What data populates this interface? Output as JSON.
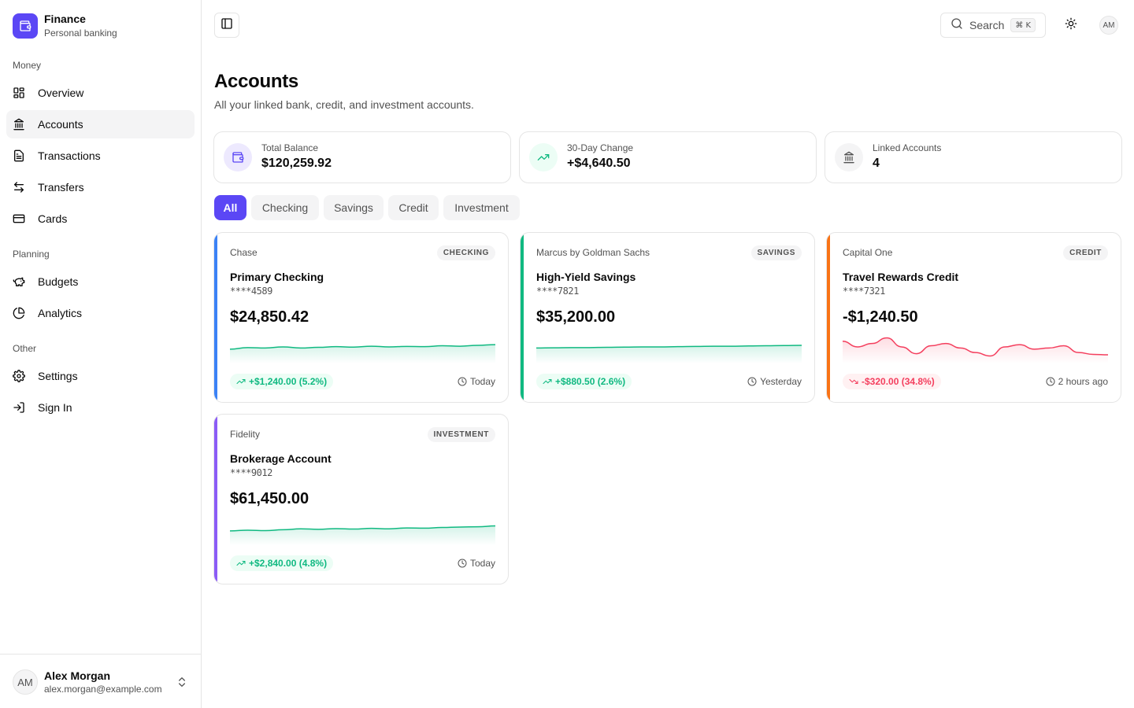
{
  "brand": {
    "title": "Finance",
    "subtitle": "Personal banking"
  },
  "sidebar": {
    "groups": [
      {
        "label": "Money",
        "items": [
          {
            "label": "Overview",
            "icon": "layout-grid-icon"
          },
          {
            "label": "Accounts",
            "icon": "landmark-icon",
            "active": true
          },
          {
            "label": "Transactions",
            "icon": "receipt-icon"
          },
          {
            "label": "Transfers",
            "icon": "arrows-left-right-icon"
          },
          {
            "label": "Cards",
            "icon": "credit-card-icon"
          }
        ]
      },
      {
        "label": "Planning",
        "items": [
          {
            "label": "Budgets",
            "icon": "piggy-bank-icon"
          },
          {
            "label": "Analytics",
            "icon": "pie-chart-icon"
          }
        ]
      },
      {
        "label": "Other",
        "items": [
          {
            "label": "Settings",
            "icon": "gear-icon"
          },
          {
            "label": "Sign In",
            "icon": "log-in-icon"
          }
        ]
      }
    ]
  },
  "user": {
    "initials": "AM",
    "name": "Alex Morgan",
    "email": "alex.morgan@example.com"
  },
  "topbar": {
    "search_label": "Search",
    "search_shortcut": "⌘ K",
    "avatar_initials": "AM"
  },
  "header": {
    "title": "Accounts",
    "subtitle": "All your linked bank, credit, and investment accounts."
  },
  "summary": [
    {
      "label": "Total Balance",
      "value": "$120,259.92",
      "icon": "wallet-icon"
    },
    {
      "label": "30-Day Change",
      "value": "+$4,640.50",
      "icon": "trending-up-icon"
    },
    {
      "label": "Linked Accounts",
      "value": "4",
      "icon": "landmark-icon"
    }
  ],
  "filters": [
    {
      "label": "All",
      "active": true
    },
    {
      "label": "Checking"
    },
    {
      "label": "Savings"
    },
    {
      "label": "Credit"
    },
    {
      "label": "Investment"
    }
  ],
  "accounts": [
    {
      "institution": "Chase",
      "type": "CHECKING",
      "name": "Primary Checking",
      "mask": "****4589",
      "balance": "$24,850.42",
      "change": "+$1,240.00 (5.2%)",
      "direction": "up",
      "updated": "Today",
      "accent_color": "#3b82f6",
      "trend": [
        0.55,
        0.48,
        0.5,
        0.45,
        0.5,
        0.47,
        0.44,
        0.46,
        0.42,
        0.45,
        0.43,
        0.44,
        0.4,
        0.42,
        0.38,
        0.35
      ]
    },
    {
      "institution": "Marcus by Goldman Sachs",
      "type": "SAVINGS",
      "name": "High-Yield Savings",
      "mask": "****7821",
      "balance": "$35,200.00",
      "change": "+$880.50 (2.6%)",
      "direction": "up",
      "updated": "Yesterday",
      "accent_color": "#10b981",
      "trend": [
        0.5,
        0.49,
        0.48,
        0.48,
        0.47,
        0.46,
        0.45,
        0.45,
        0.44,
        0.43,
        0.42,
        0.42,
        0.41,
        0.4,
        0.39,
        0.38
      ]
    },
    {
      "institution": "Capital One",
      "type": "CREDIT",
      "name": "Travel Rewards Credit",
      "mask": "****7321",
      "balance": "-$1,240.50",
      "change": "-$320.00 (34.8%)",
      "direction": "down",
      "updated": "2 hours ago",
      "accent_color": "#f97316",
      "trend": [
        0.2,
        0.45,
        0.3,
        0.05,
        0.45,
        0.75,
        0.4,
        0.3,
        0.5,
        0.7,
        0.85,
        0.45,
        0.35,
        0.55,
        0.5,
        0.4,
        0.7,
        0.78,
        0.8
      ]
    },
    {
      "institution": "Fidelity",
      "type": "INVESTMENT",
      "name": "Brokerage Account",
      "mask": "****9012",
      "balance": "$61,450.00",
      "change": "+$2,840.00 (4.8%)",
      "direction": "up",
      "updated": "Today",
      "accent_color": "#8b5cf6",
      "trend": [
        0.55,
        0.52,
        0.54,
        0.5,
        0.46,
        0.48,
        0.45,
        0.47,
        0.44,
        0.46,
        0.42,
        0.43,
        0.4,
        0.38,
        0.37,
        0.33
      ]
    }
  ],
  "colors": {
    "accent": "#5b47f5",
    "positive": "#10b981",
    "negative": "#f43f5e"
  }
}
